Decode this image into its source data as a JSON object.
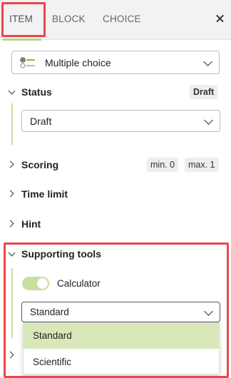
{
  "tabs": [
    {
      "label": "ITEM",
      "active": true
    },
    {
      "label": "BLOCK",
      "active": false
    },
    {
      "label": "CHOICE",
      "active": false
    }
  ],
  "type_select": {
    "value": "Multiple choice",
    "icon": "multiple-choice-icon"
  },
  "sections": {
    "status": {
      "title": "Status",
      "badge": "Draft",
      "select_value": "Draft"
    },
    "scoring": {
      "title": "Scoring",
      "min_badge": "min. 0",
      "max_badge": "max. 1"
    },
    "time_limit": {
      "title": "Time limit"
    },
    "hint": {
      "title": "Hint"
    },
    "supporting_tools": {
      "title": "Supporting tools",
      "calculator_label": "Calculator",
      "calculator_enabled": true,
      "calculator_select_value": "Standard",
      "options": [
        "Standard",
        "Scientific"
      ]
    }
  },
  "colors": {
    "accent": "#c9dea1",
    "selected_option": "#d8e8b8",
    "highlight": "#e8474c"
  }
}
